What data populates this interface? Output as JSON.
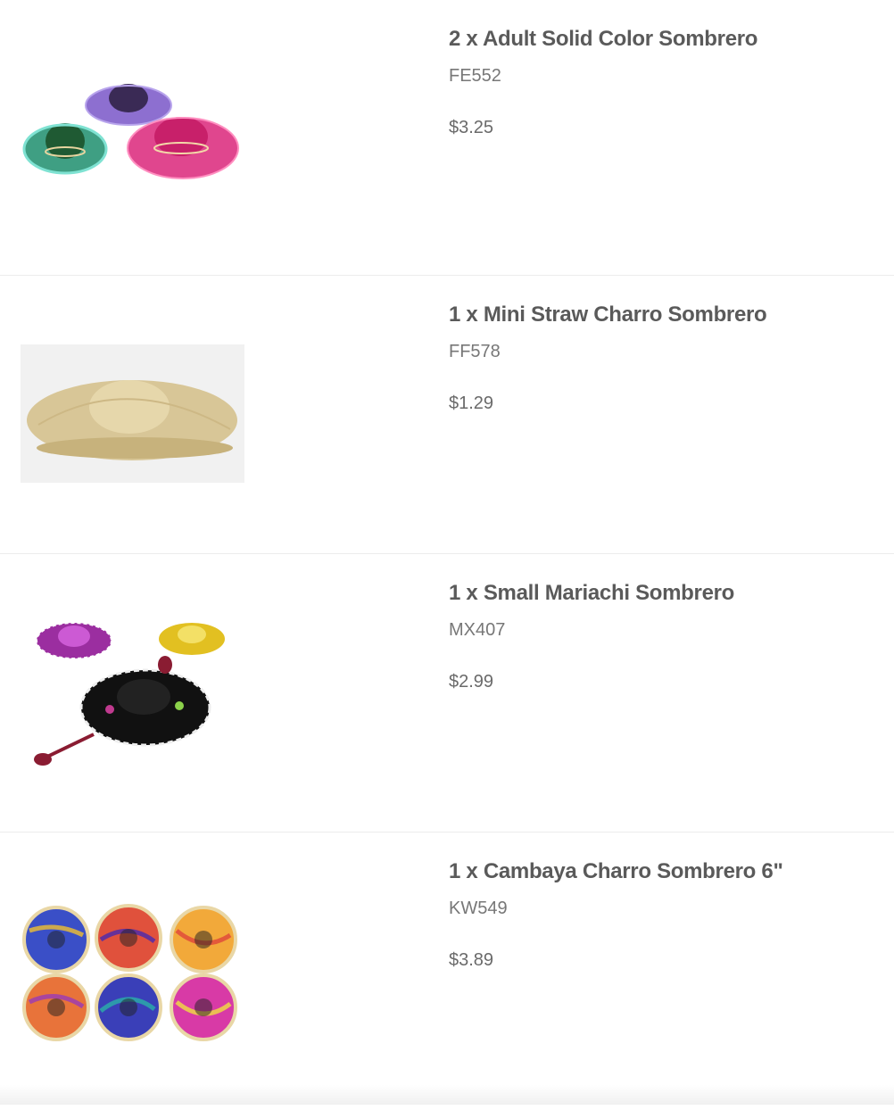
{
  "cart": {
    "items": [
      {
        "title": "2 x Adult Solid Color Sombrero",
        "sku": "FE552",
        "price": "$3.25",
        "image_icon": "three-straw-sombreros-image"
      },
      {
        "title": "1 x Mini Straw Charro Sombrero",
        "sku": "FF578",
        "price": "$1.29",
        "image_icon": "straw-sombrero-image"
      },
      {
        "title": "1 x Small Mariachi Sombrero",
        "sku": "MX407",
        "price": "$2.99",
        "image_icon": "mariachi-sombreros-image"
      },
      {
        "title": "1 x Cambaya Charro Sombrero 6\"",
        "sku": "KW549",
        "price": "$3.89",
        "image_icon": "cambaya-sombreros-image"
      }
    ]
  }
}
